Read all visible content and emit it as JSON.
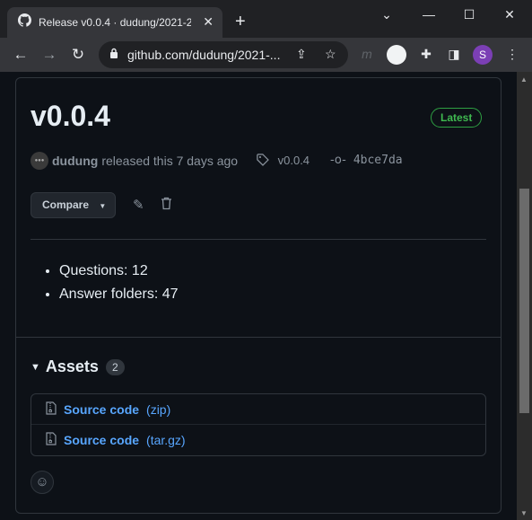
{
  "browser": {
    "tab_title": "Release v0.0.4 · dudung/2021-2-f",
    "tab_close": "✕",
    "new_tab": "+",
    "win_min": "—",
    "win_max": "☐",
    "win_close": "✕",
    "url": "github.com/dudung/2021-...",
    "avatar_letter": "S"
  },
  "release": {
    "version": "v0.0.4",
    "badge": "Latest",
    "author": "dudung",
    "released_text": "released this 7 days ago",
    "tag": "v0.0.4",
    "commit": "4bce7da",
    "compare_label": "Compare",
    "notes": [
      "Questions: 12",
      "Answer folders: 47"
    ]
  },
  "assets": {
    "heading": "Assets",
    "count": "2",
    "items": [
      {
        "name": "Source code",
        "format": "(zip)"
      },
      {
        "name": "Source code",
        "format": "(tar.gz)"
      }
    ]
  }
}
